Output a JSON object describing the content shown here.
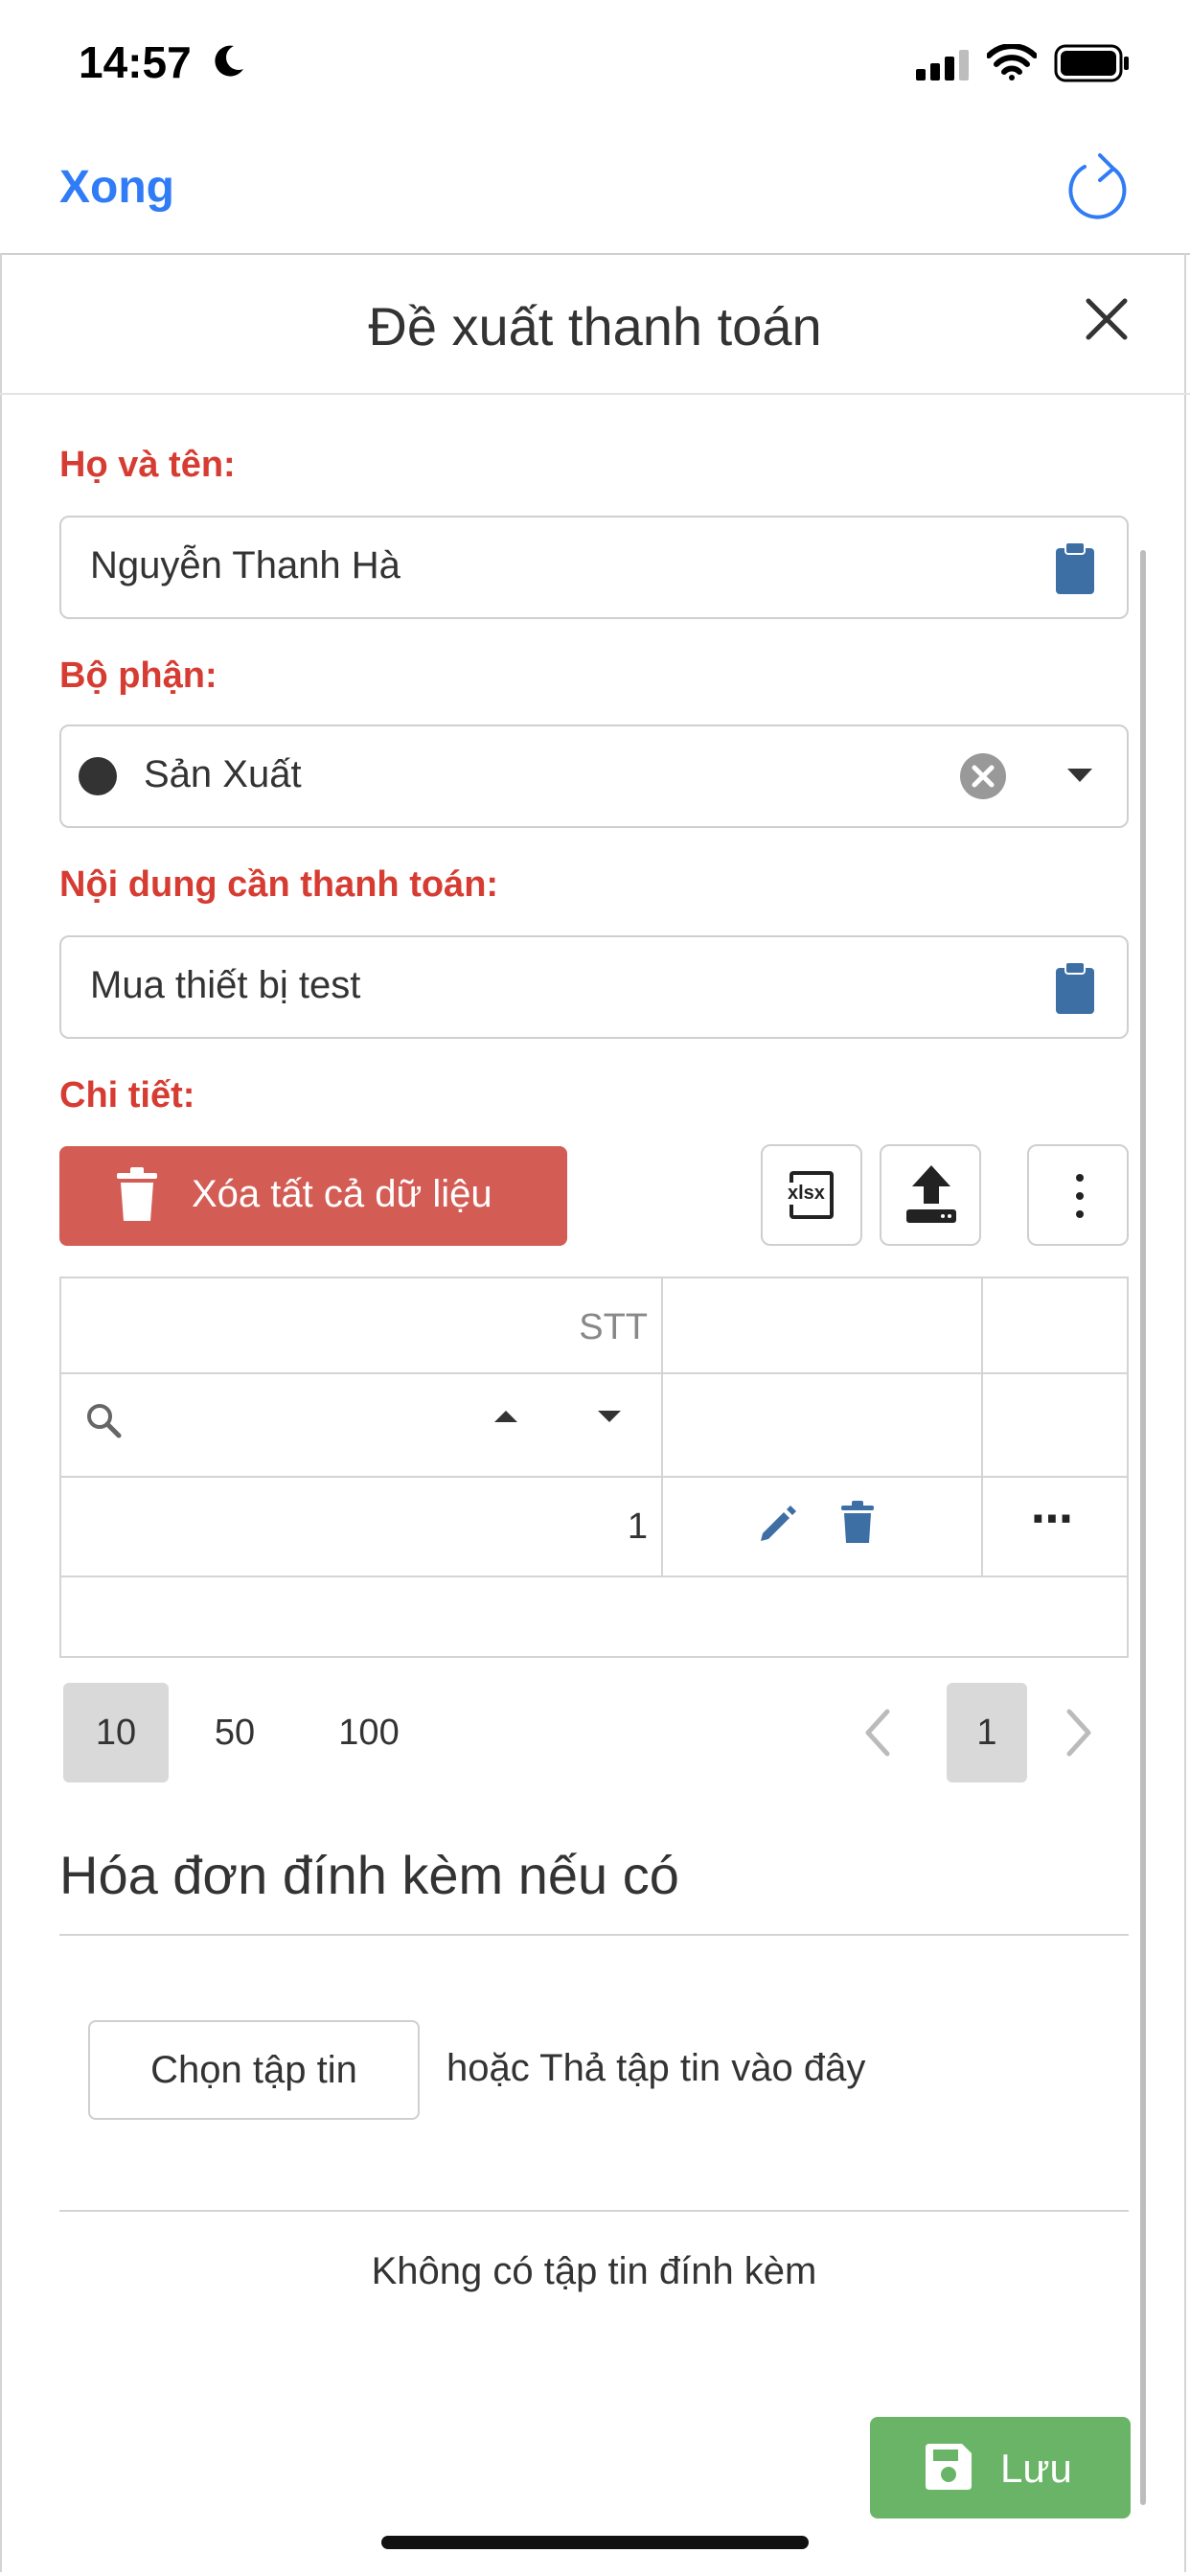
{
  "status_bar": {
    "time": "14:57"
  },
  "nav": {
    "done_label": "Xong"
  },
  "modal": {
    "title": "Đề xuất thanh toán"
  },
  "form": {
    "name_label": "Họ và tên:",
    "name_value": "Nguyễn Thanh Hà",
    "department_label": "Bộ phận:",
    "department_value": "Sản Xuất",
    "content_label": "Nội dung cần thanh toán:",
    "content_value": "Mua thiết bị test",
    "details_label": "Chi tiết:"
  },
  "toolbar": {
    "clear_all_label": "Xóa tất cả dữ liệu",
    "xlsx_label": "xlsx"
  },
  "table": {
    "columns": [
      "STT",
      "",
      ""
    ],
    "rows": [
      {
        "stt": "1"
      }
    ],
    "more_label": "⋯"
  },
  "pagination": {
    "page_sizes": [
      "10",
      "50",
      "100"
    ],
    "current_page": "1"
  },
  "attachments": {
    "title": "Hóa đơn đính kèm nếu có",
    "choose_label": "Chọn tập tin",
    "drop_text": "hoặc Thả tập tin vào đây",
    "empty_text": "Không có tập tin đính kèm"
  },
  "footer": {
    "save_label": "Lưu"
  },
  "colors": {
    "accent_blue": "#2f7cf6",
    "label_red": "#d63c32",
    "danger_button": "#d35d55",
    "save_green": "#6ab468",
    "icon_blue": "#3d6fa5"
  }
}
